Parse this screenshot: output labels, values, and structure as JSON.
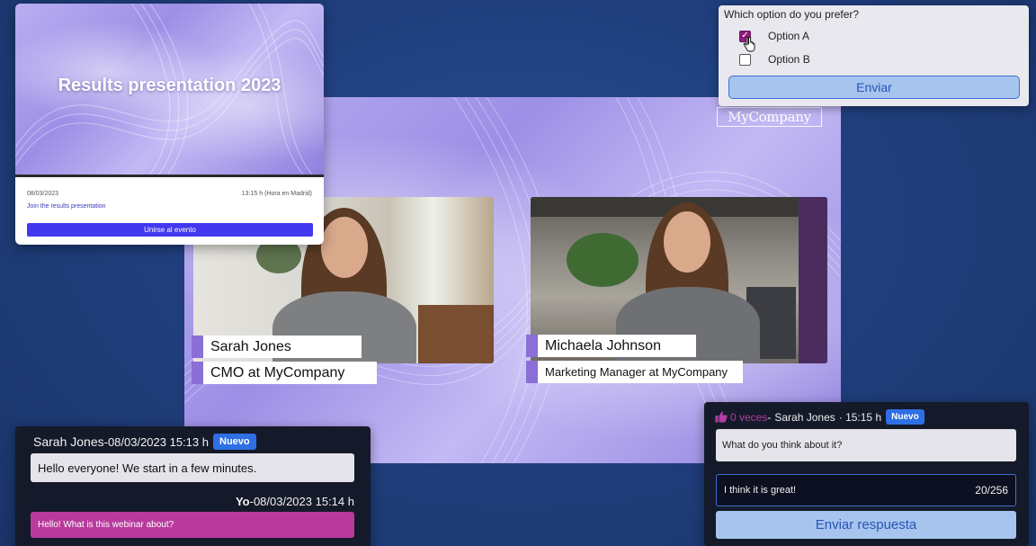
{
  "stage": {
    "brand": "MyCompany",
    "speakers": [
      {
        "name": "Sarah Jones",
        "title": "CMO at MyCompany"
      },
      {
        "name": "Michaela Johnson",
        "title": "Marketing Manager at MyCompany"
      }
    ]
  },
  "event_card": {
    "title": "Results presentation 2023",
    "date": "08/03/2023",
    "time": "13:15 h (Hora en Madrid)",
    "link_text": "Join the results presentation",
    "join_label": "Unirse al evento"
  },
  "poll": {
    "question": "Which option do you prefer?",
    "options": [
      {
        "label": "Option A",
        "checked": true
      },
      {
        "label": "Option B",
        "checked": false
      }
    ],
    "submit_label": "Enviar"
  },
  "chat": {
    "messages": [
      {
        "author": "Sarah Jones",
        "datetime": "-08/03/2023  15:13 h",
        "badge": "Nuevo",
        "text": "Hello everyone! We start in a few minutes."
      },
      {
        "author": "Yo",
        "datetime": "-08/03/2023  15:14 h",
        "text": "Hello! What is this webinar about?"
      }
    ]
  },
  "qa": {
    "likes": "0 veces",
    "separator": " - ",
    "author": "Sarah Jones",
    "time": "· 15:15 h",
    "badge": "Nuevo",
    "question": "What do you think about it?",
    "answer_value": "I think it is great!",
    "counter": "20/256",
    "submit_label": "Enviar respuesta"
  },
  "colors": {
    "accent": "#4338ef",
    "badge": "#2f6fe4",
    "own_message": "#b83b9c",
    "button_light": "#a6c4ee"
  }
}
